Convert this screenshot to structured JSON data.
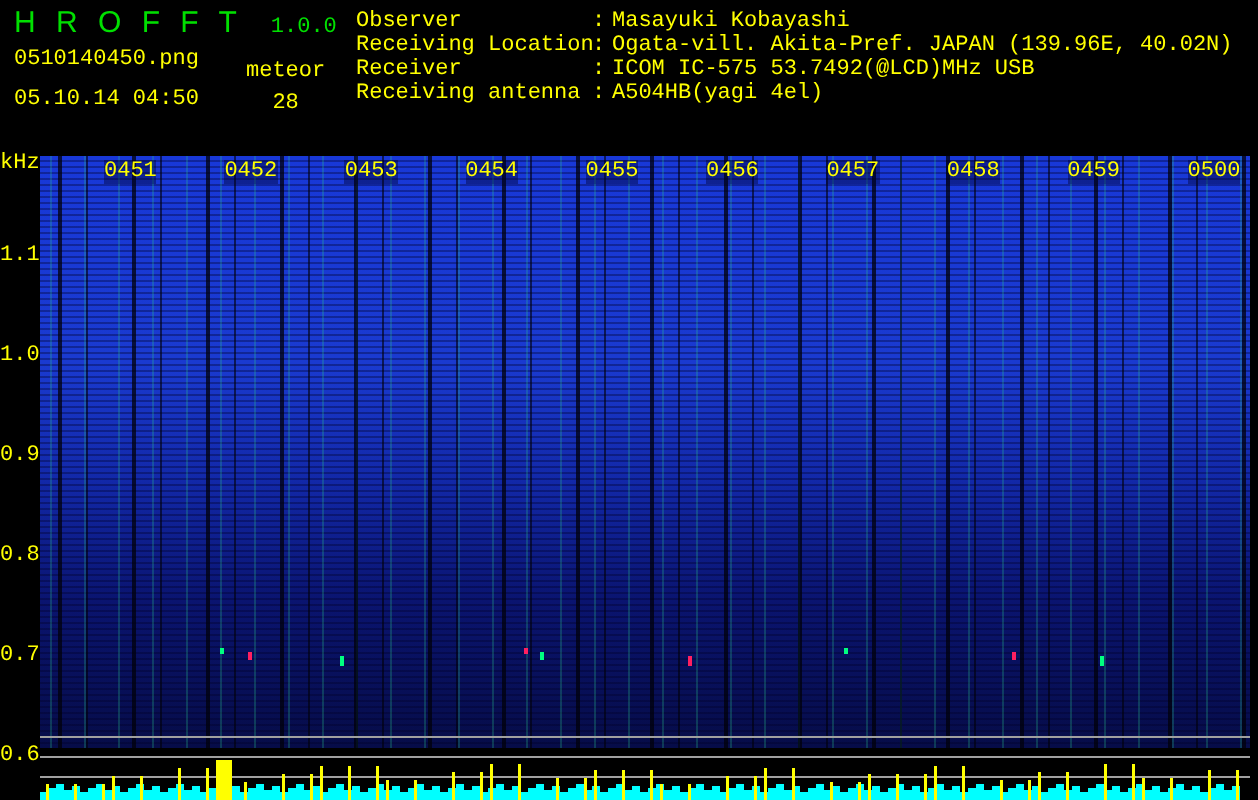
{
  "app": {
    "name": "H R O F F T",
    "version": "1.0.0"
  },
  "file": {
    "name": "0510140450.png",
    "datetime": "05.10.14 04:50"
  },
  "meteor": {
    "label": "meteor",
    "count": "28"
  },
  "station": [
    {
      "label": "Observer",
      "separator": ":",
      "value": "Masayuki Kobayashi"
    },
    {
      "label": "Receiving Location",
      "separator": ":",
      "value": "Ogata-vill. Akita-Pref. JAPAN (139.96E, 40.02N)"
    },
    {
      "label": "Receiver",
      "separator": ":",
      "value": "ICOM IC-575 53.7492(@LCD)MHz USB"
    },
    {
      "label": "Receiving antenna",
      "separator": ":",
      "value": "A504HB(yagi 4el)"
    }
  ],
  "spectrogram": {
    "unit": "kHz",
    "y_labels": [
      "1.1",
      "1.0",
      "0.9",
      "0.8",
      "0.7",
      "0.6"
    ],
    "time_labels": [
      "0451",
      "0452",
      "0453",
      "0454",
      "0455",
      "0456",
      "0457",
      "0458",
      "0459",
      "0500"
    ]
  }
}
